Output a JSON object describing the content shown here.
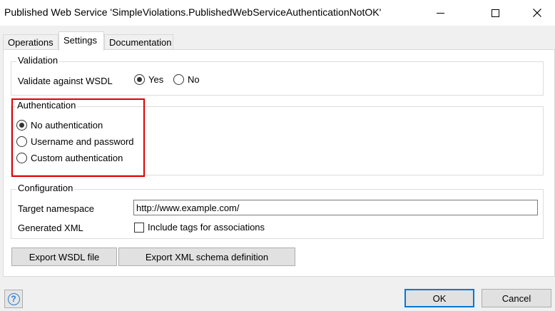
{
  "window": {
    "title": "Published Web Service 'SimpleViolations.PublishedWebServiceAuthenticationNotOK'"
  },
  "tabs": [
    {
      "label": "Operations",
      "active": false
    },
    {
      "label": "Settings",
      "active": true
    },
    {
      "label": "Documentation",
      "active": false
    }
  ],
  "validation": {
    "group_label": "Validation",
    "field_label": "Validate against WSDL",
    "options": [
      {
        "label": "Yes",
        "selected": true
      },
      {
        "label": "No",
        "selected": false
      }
    ]
  },
  "authentication": {
    "group_label": "Authentication",
    "options": [
      {
        "label": "No authentication",
        "selected": true
      },
      {
        "label": "Username and password",
        "selected": false
      },
      {
        "label": "Custom authentication",
        "selected": false
      }
    ],
    "highlight_color": "#e00000"
  },
  "configuration": {
    "group_label": "Configuration",
    "namespace_label": "Target namespace",
    "namespace_value": "http://www.example.com/",
    "xml_label": "Generated XML",
    "include_tags_label": "Include tags for associations",
    "include_tags_checked": false
  },
  "actions": {
    "export_wsdl": "Export WSDL file",
    "export_xsd": "Export XML schema definition"
  },
  "footer": {
    "ok": "OK",
    "cancel": "Cancel",
    "help_glyph": "?"
  },
  "colors": {
    "accent": "#0078d7",
    "help_icon": "#2a7ad5"
  }
}
